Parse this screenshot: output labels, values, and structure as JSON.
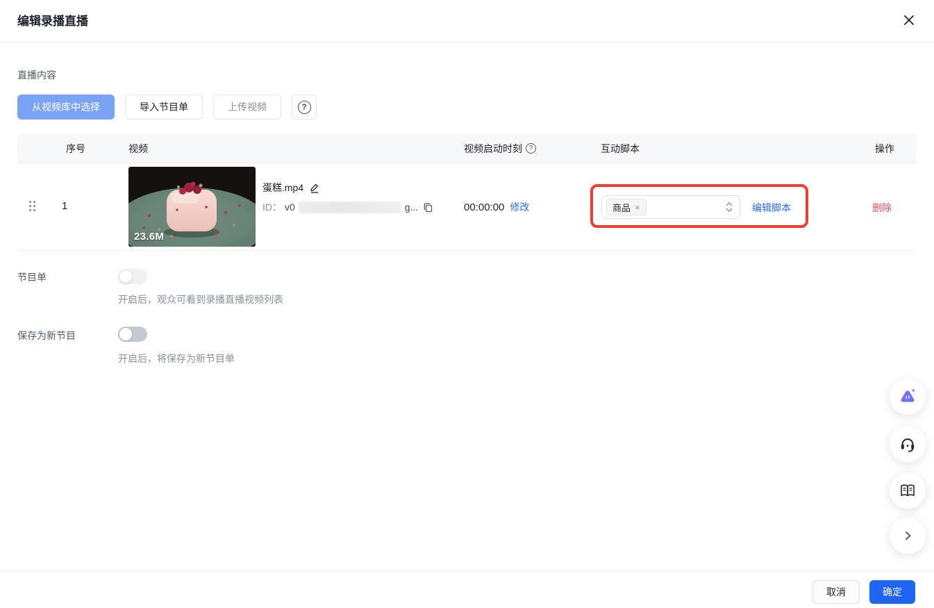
{
  "dialog": {
    "title": "编辑录播直播"
  },
  "icons": {
    "question": "?"
  },
  "section": {
    "label": "直播内容",
    "tabs": [
      {
        "label": "从视频库中选择",
        "active": true
      },
      {
        "label": "导入节目单",
        "active": false
      },
      {
        "label": "上传视频",
        "active": false
      }
    ]
  },
  "table": {
    "headers": {
      "index": "序号",
      "video": "视频",
      "start_time": "视频启动时刻",
      "script": "互动脚本",
      "action": "操作"
    },
    "row": {
      "index": "1",
      "size_badge": "23.6M",
      "filename": "蛋糕.mp4",
      "id_label": "ID：",
      "id_visible_prefix": "v0",
      "id_visible_suffix": "g...",
      "start_time": "00:00:00",
      "modify_link": "修改",
      "script_tag": "商品",
      "tag_remove": "×",
      "edit_script_link": "编辑脚本",
      "delete_link": "删除"
    }
  },
  "playlist": {
    "label": "节目单",
    "enabled": false,
    "helper": "开启后，观众可看到录播直播视频列表"
  },
  "save_program": {
    "label": "保存为新节目",
    "enabled": false,
    "helper": "开启后，将保存为新节目单"
  },
  "footer": {
    "cancel": "取消",
    "confirm": "确定"
  },
  "floating_buttons": [
    "ai-assistant",
    "customer-service",
    "manual",
    "collapse"
  ],
  "colors": {
    "primary": "#1f64f2",
    "active_tab": "#7ba3f5",
    "link": "#2a6af2",
    "danger": "#e34d59",
    "annotation": "#f23c2e",
    "table_header_bg": "#f7f8fa"
  }
}
